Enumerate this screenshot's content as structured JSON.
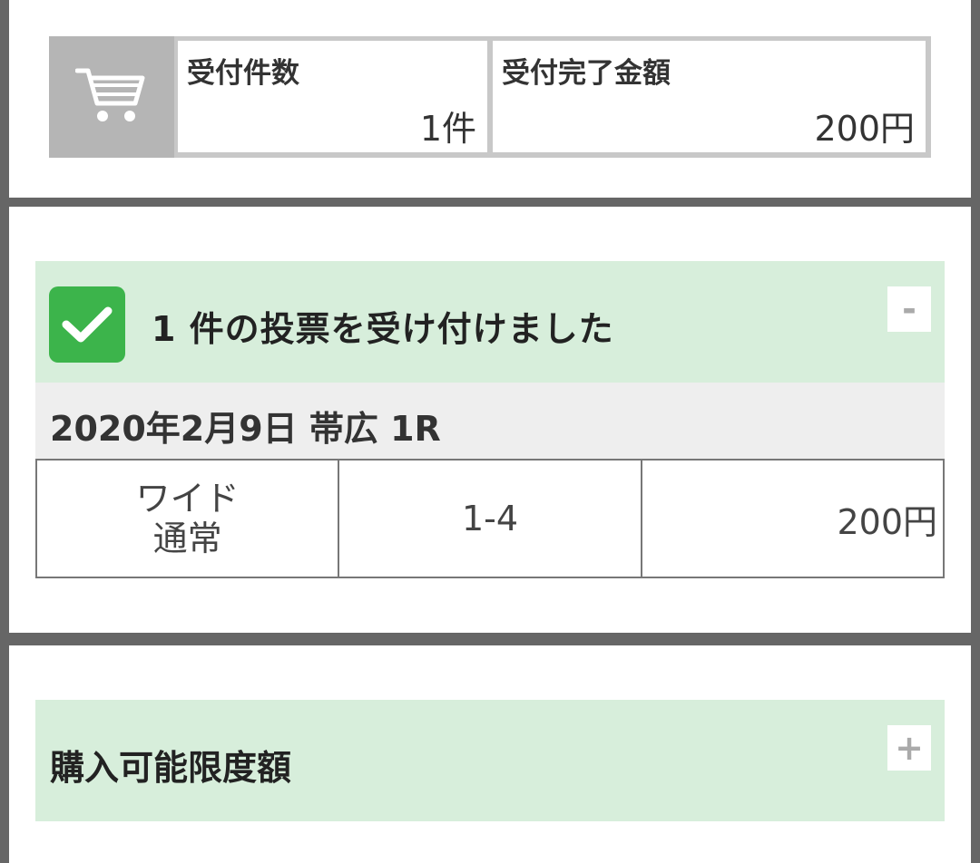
{
  "summary": {
    "cart_icon": "cart-icon",
    "count_label": "受付件数",
    "count_value": "1件",
    "amount_label": "受付完了金額",
    "amount_value": "200円"
  },
  "result": {
    "check_icon": "check-icon",
    "title": "1 件の投票を受け付けました",
    "toggle": "-",
    "race": "2020年2月9日 帯広 1R",
    "bets": [
      {
        "type_line1": "ワイド",
        "type_line2": "通常",
        "combination": "1-4",
        "amount": "200円"
      }
    ]
  },
  "limit": {
    "title": "購入可能限度額",
    "toggle": "+"
  },
  "colors": {
    "accent_green": "#3cb44b",
    "header_bg": "#d7eedb",
    "frame": "#666666"
  }
}
